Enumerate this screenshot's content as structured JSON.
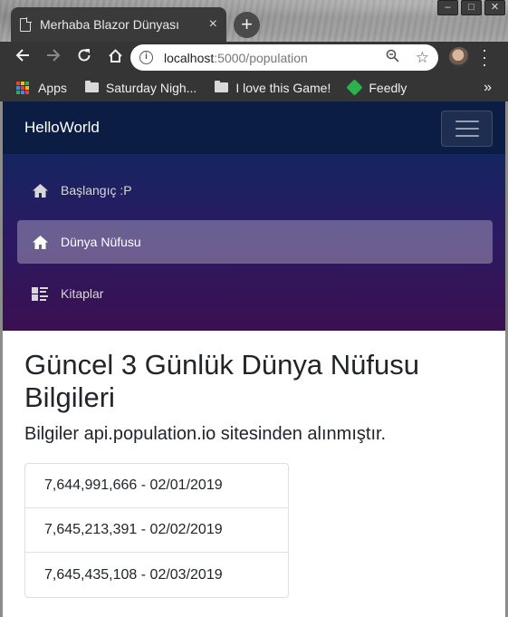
{
  "browser": {
    "tab_title": "Merhaba Blazor Dünyası",
    "tab_close": "×",
    "new_tab": "+",
    "window_buttons": [
      "–",
      "□",
      "✕"
    ],
    "url_host": "localhost",
    "url_rest": ":5000/population",
    "bookmarks": [
      {
        "label": "Apps",
        "icon": "apps-grid-icon"
      },
      {
        "label": "Saturday Nigh...",
        "icon": "folder-icon"
      },
      {
        "label": "I love this Game!",
        "icon": "folder-icon"
      },
      {
        "label": "Feedly",
        "icon": "feedly-icon"
      }
    ],
    "bookmarks_more": "»"
  },
  "app": {
    "brand": "HelloWorld",
    "nav": [
      {
        "label": "Başlangıç :P",
        "icon": "home-icon",
        "active": false
      },
      {
        "label": "Dünya Nüfusu",
        "icon": "home-icon",
        "active": true
      },
      {
        "label": "Kitaplar",
        "icon": "list-icon",
        "active": false
      }
    ]
  },
  "main": {
    "title": "Güncel 3 Günlük Dünya Nüfusu Bilgileri",
    "subtitle": "Bilgiler api.population.io sitesinden alınmıştır.",
    "items": [
      "7,644,991,666 - 02/01/2019",
      "7,645,213,391 - 02/02/2019",
      "7,645,435,108 - 02/03/2019"
    ]
  },
  "colors": {
    "header_bg": "#0b1d42",
    "sidebar_top": "#142560",
    "sidebar_bottom": "#3a1050",
    "apps_grid": [
      "#e94235",
      "#fbbc04",
      "#34a853",
      "#4285f4",
      "#e94235",
      "#fbbc04",
      "#34a853",
      "#4285f4",
      "#e94235"
    ]
  }
}
